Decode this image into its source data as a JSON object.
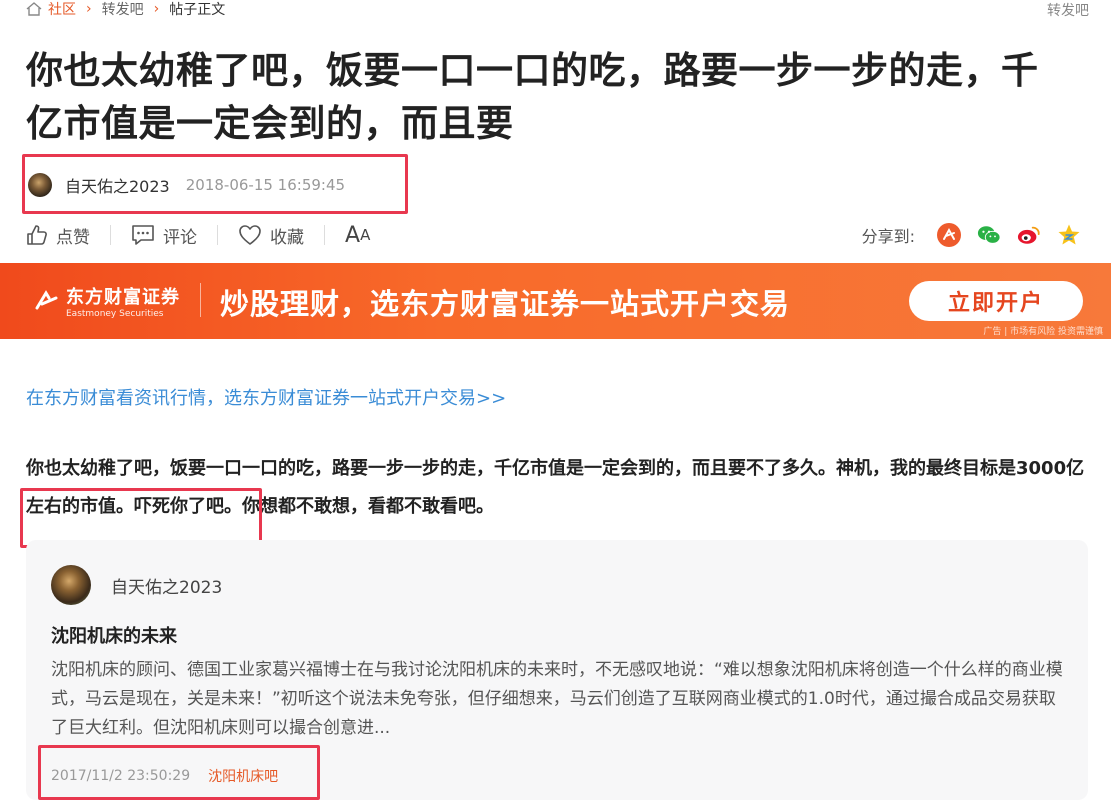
{
  "breadcrumb": {
    "items": [
      "社区",
      "转发吧",
      "帖子正文"
    ]
  },
  "top_right_link": "转发吧",
  "post": {
    "title": "你也太幼稚了吧，饭要一口一口的吃，路要一步一步的走，千亿市值是一定会到的，而且要",
    "author": "自天佑之2023",
    "time": "2018-06-15 16:59:45",
    "body": "你也太幼稚了吧，饭要一口一口的吃，路要一步一步的走，千亿市值是一定会到的，而且要不了多久。神机，我的最终目标是3000亿左右的市值。吓死你了吧。你想都不敢想，看都不敢看吧。"
  },
  "toolbar": {
    "like_label": "点赞",
    "comment_label": "评论",
    "favorite_label": "收藏",
    "font_size_label_big": "A",
    "font_size_label_small": "A"
  },
  "share": {
    "label": "分享到:",
    "icons": [
      "share-eastmoney-icon",
      "wechat-icon",
      "weibo-icon",
      "qzone-icon"
    ]
  },
  "banner": {
    "logo_cn": "东方财富证券",
    "logo_en": "Eastmoney Securities",
    "slogan": "炒股理财，选东方财富证券一站式开户交易",
    "button_label": "立即开户",
    "ad_note": "广告 | 市场有风险 投资需谨慎",
    "colors": {
      "start": "#f04a1c",
      "end": "#f7793a",
      "button_text": "#e5461f"
    }
  },
  "promo_link": "在东方财富看资讯行情，选东方财富证券一站式开户交易>>",
  "quote_card": {
    "author": "自天佑之2023",
    "title": "沈阳机床的未来",
    "excerpt": "沈阳机床的顾问、德国工业家葛兴福博士在与我讨论沈阳机床的未来时，不无感叹地说：“难以想象沈阳机床将创造一个什么样的商业模式，马云是现在，关是未来！”初听这个说法未免夸张，但仔细想来，马云们创造了互联网商业模式的1.0时代，通过撮合成品交易获取了巨大红利。但沈阳机床则可以撮合创意进...",
    "date": "2017/11/2 23:50:29",
    "forum": "沈阳机床吧"
  },
  "colors": {
    "accent": "#e65a28",
    "link": "#3a8cd6",
    "highlight_box": "#e8384f"
  }
}
